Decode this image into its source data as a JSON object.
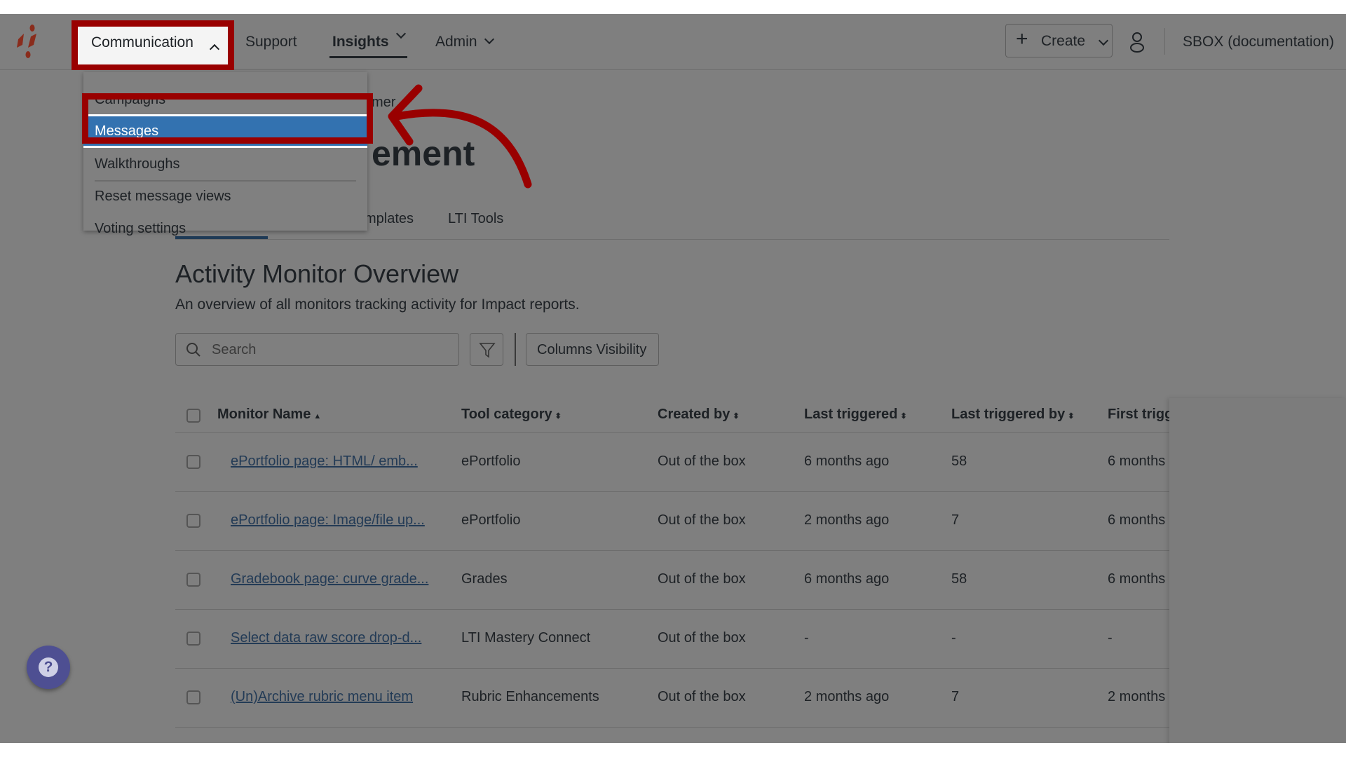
{
  "nav": {
    "items": [
      {
        "label": "Communication",
        "state": "open"
      },
      {
        "label": "Support"
      },
      {
        "label": "Insights",
        "state": "active"
      },
      {
        "label": "Admin"
      }
    ],
    "create_label": "Create",
    "account_label": "SBOX (documentation)"
  },
  "communication_menu": {
    "items": [
      "Campaigns",
      "Messages",
      "Walkthroughs",
      "Reset message views",
      "Voting settings"
    ],
    "selected": "Messages"
  },
  "behind_menu": {
    "breadcrumb_fragment": "mer",
    "title_fragment": "ement",
    "tabs": [
      "mplates",
      "LTI Tools"
    ]
  },
  "section": {
    "title": "Activity Monitor Overview",
    "subtitle": "An overview of all monitors tracking activity for Impact reports."
  },
  "toolbar": {
    "search_placeholder": "Search",
    "columns_visibility_label": "Columns Visibility"
  },
  "table": {
    "columns": [
      "Monitor Name",
      "Tool category",
      "Created by",
      "Last triggered",
      "Last triggered by",
      "First trigg"
    ],
    "rows": [
      [
        "ePortfolio page: HTML/ emb...",
        "ePortfolio",
        "Out of the box",
        "6 months ago",
        "58",
        "6 months"
      ],
      [
        "ePortfolio page: Image/file up...",
        "ePortfolio",
        "Out of the box",
        "2 months ago",
        "7",
        "6 months"
      ],
      [
        "Gradebook page: curve grade...",
        "Grades",
        "Out of the box",
        "6 months ago",
        "58",
        "6 months"
      ],
      [
        "Select data raw score drop-d...",
        "LTI Mastery Connect",
        "Out of the box",
        "-",
        "-",
        "-"
      ],
      [
        "(Un)Archive rubric menu item",
        "Rubric Enhancements",
        "Out of the box",
        "2 months ago",
        "7",
        "2 months"
      ]
    ]
  },
  "colors": {
    "highlight": "#990000",
    "selected_item": "#3372b0",
    "link": "#233b56",
    "help_button": "#4e4f92"
  }
}
